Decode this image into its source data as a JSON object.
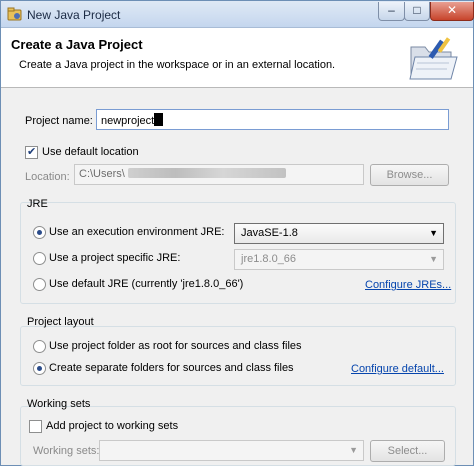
{
  "window": {
    "title": "New Java Project",
    "controls": {
      "minimize": "–",
      "maximize": "□",
      "close": "✕"
    }
  },
  "banner": {
    "title": "Create a Java Project",
    "description": "Create a Java project in the workspace or in an external location.",
    "icon": "java-project-folder-icon"
  },
  "project": {
    "name_label": "Project name:",
    "name_value": "newproject",
    "use_default_location_label": "Use default location",
    "use_default_location_checked": true,
    "location_label": "Location:",
    "location_value": "C:\\Users\\",
    "browse_label": "Browse..."
  },
  "jre": {
    "group_label": "JRE",
    "options": [
      {
        "label": "Use an execution environment JRE:",
        "selected": true
      },
      {
        "label": "Use a project specific JRE:",
        "selected": false
      },
      {
        "label": "Use default JRE (currently 'jre1.8.0_66')",
        "selected": false
      }
    ],
    "execution_env_value": "JavaSE-1.8",
    "project_specific_value": "jre1.8.0_66",
    "configure_link": "Configure JREs..."
  },
  "layout": {
    "group_label": "Project layout",
    "options": [
      {
        "label": "Use project folder as root for sources and class files",
        "selected": false
      },
      {
        "label": "Create separate folders for sources and class files",
        "selected": true
      }
    ],
    "configure_link": "Configure default..."
  },
  "working_sets": {
    "group_label": "Working sets",
    "add_label": "Add project to working sets",
    "add_checked": false,
    "sets_label": "Working sets:",
    "select_label": "Select..."
  },
  "colors": {
    "accent": "#0645ad",
    "titlebar": "#c4d6ee",
    "close_button": "#c7442b"
  }
}
